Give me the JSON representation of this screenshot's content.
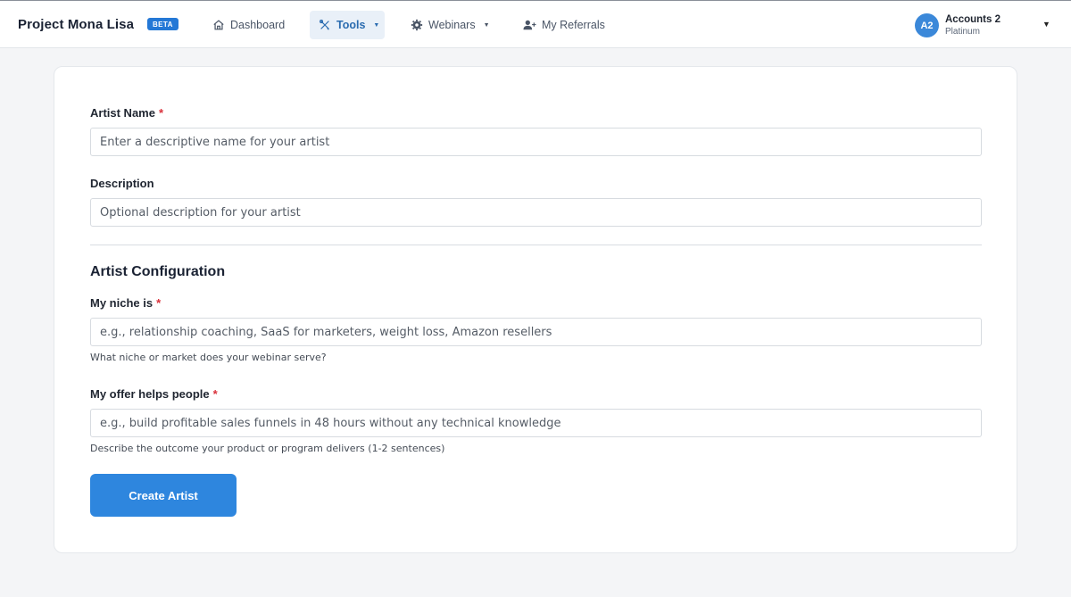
{
  "header": {
    "brand": "Project Mona Lisa",
    "badge": "BETA",
    "nav": [
      {
        "label": "Dashboard",
        "icon": "home-icon"
      },
      {
        "label": "Tools",
        "icon": "tools-icon",
        "active": true
      },
      {
        "label": "Webinars",
        "icon": "gear-icon"
      },
      {
        "label": "My Referrals",
        "icon": "user-plus-icon"
      }
    ],
    "account": {
      "initials": "A2",
      "name": "Accounts 2",
      "plan": "Platinum"
    }
  },
  "form": {
    "artist_name": {
      "label": "Artist Name",
      "required_mark": "*",
      "placeholder": "Enter a descriptive name for your artist",
      "value": ""
    },
    "description": {
      "label": "Description",
      "placeholder": "Optional description for your artist",
      "value": ""
    },
    "section_title": "Artist Configuration",
    "niche": {
      "label": "My niche is",
      "required_mark": "*",
      "placeholder": "e.g., relationship coaching, SaaS for marketers, weight loss, Amazon resellers",
      "value": "",
      "help": "What niche or market does your webinar serve?"
    },
    "offer": {
      "label": "My offer helps people",
      "required_mark": "*",
      "placeholder": "e.g., build profitable sales funnels in 48 hours without any technical knowledge",
      "value": "",
      "help": "Describe the outcome your product or program delivers (1-2 sentences)"
    },
    "submit_label": "Create Artist"
  },
  "colors": {
    "accent": "#2e86de",
    "badge": "#2478d6",
    "required": "#d9303a",
    "active_nav_bg": "#e9f0f8"
  }
}
